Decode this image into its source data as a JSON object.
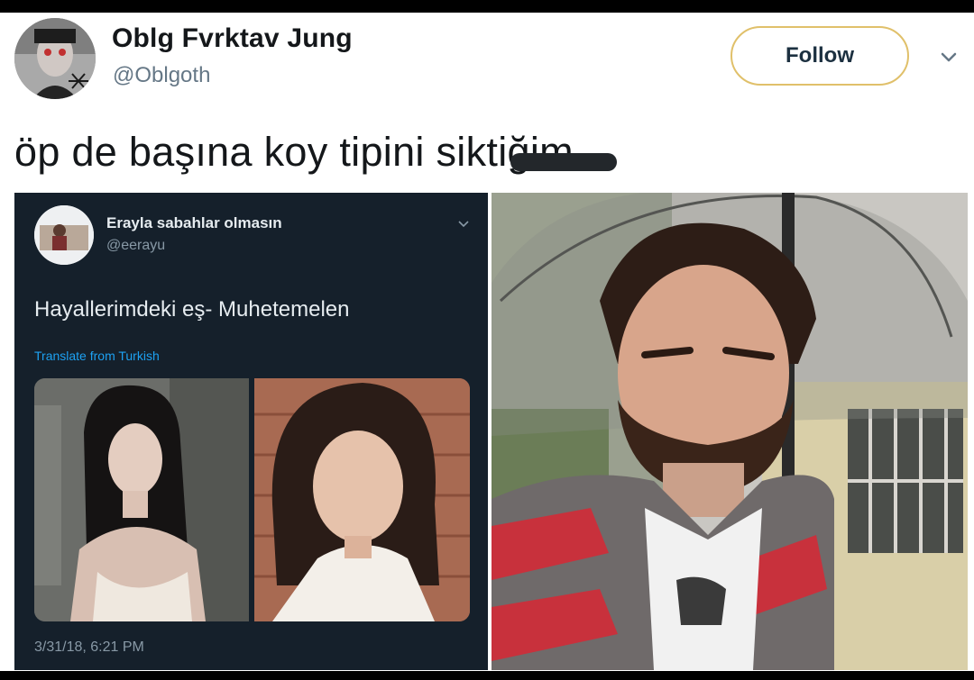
{
  "tweet": {
    "author": {
      "display_name": "Oblg Fvrktav Jung",
      "handle": "@Oblgoth"
    },
    "follow_label": "Follow",
    "text": "öp de başına koy tipini siktiğim"
  },
  "quoted": {
    "author": {
      "display_name": "Erayla sabahlar olmasın",
      "handle": "@eerayu"
    },
    "text": "Hayallerimdeki eş- Muhetemelen",
    "translate_label": "Translate from Turkish",
    "timestamp": "3/31/18, 6:21 PM"
  },
  "colors": {
    "follow_border": "#e0c06a",
    "dark_bg": "#15202b",
    "link": "#1da1f2"
  },
  "icons": {
    "more": "chevron-down-icon"
  }
}
